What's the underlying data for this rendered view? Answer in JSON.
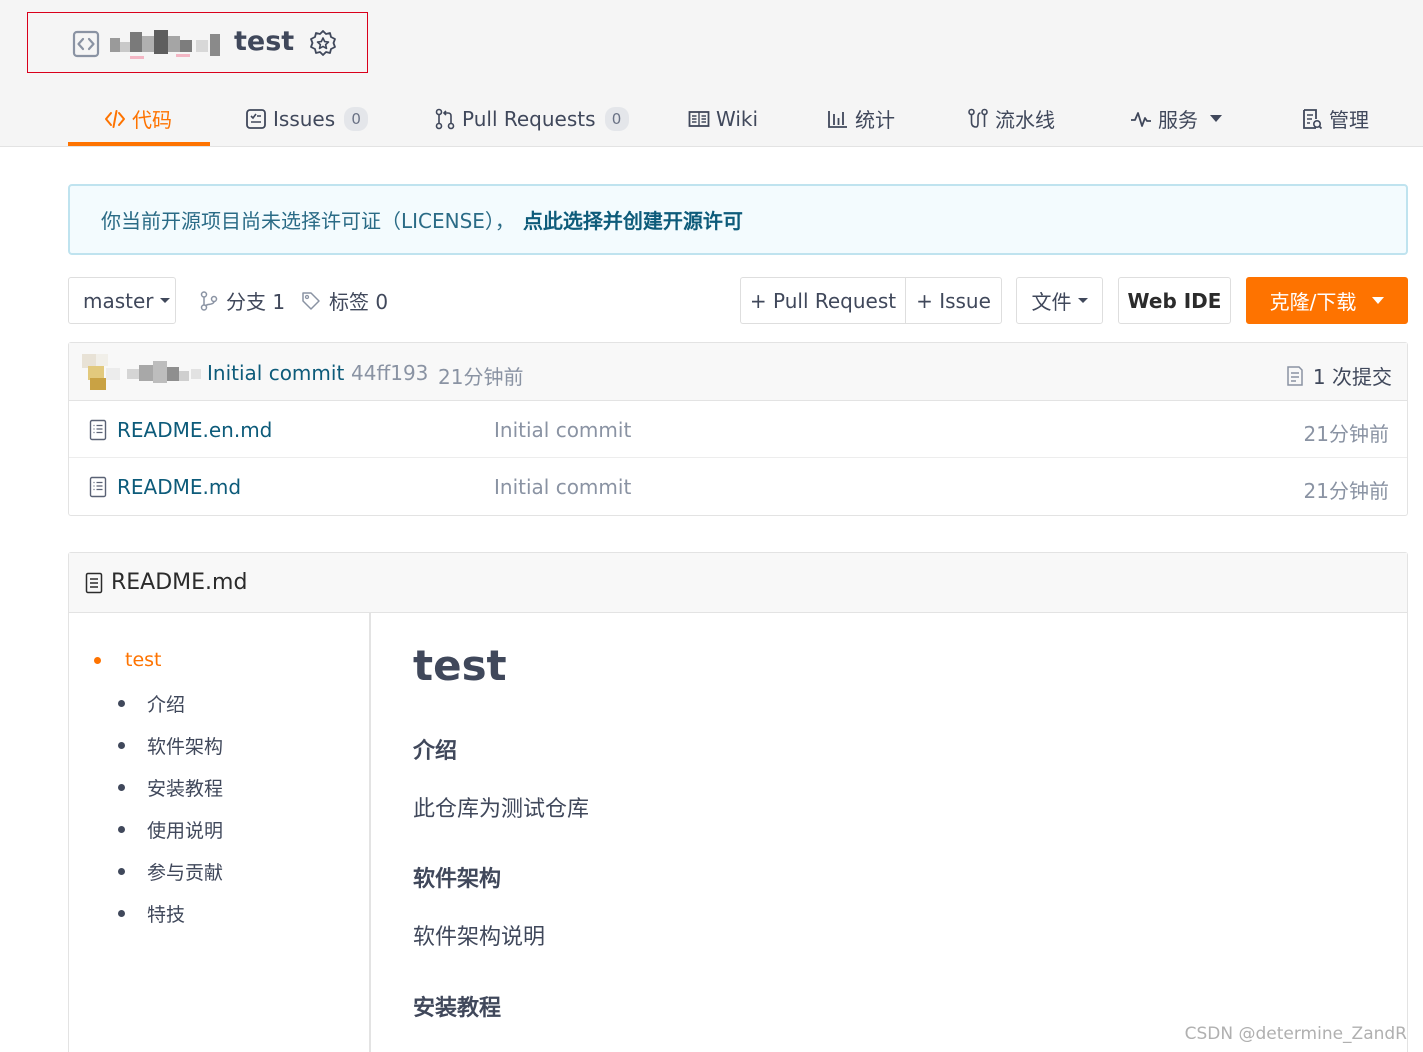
{
  "repo": {
    "name": "test"
  },
  "tabs": [
    {
      "label": "代码",
      "icon": "code-icon"
    },
    {
      "label": "Issues",
      "count": "0",
      "icon": "issues-icon"
    },
    {
      "label": "Pull Requests",
      "count": "0",
      "icon": "pull-request-icon"
    },
    {
      "label": "Wiki",
      "icon": "wiki-icon"
    },
    {
      "label": "统计",
      "icon": "stats-icon"
    },
    {
      "label": "流水线",
      "icon": "pipeline-icon"
    },
    {
      "label": "服务",
      "icon": "pulse-icon"
    },
    {
      "label": "管理",
      "icon": "manage-icon"
    }
  ],
  "notice": {
    "text": "你当前开源项目尚未选择许可证（LICENSE），",
    "link": "点此选择并创建开源许可"
  },
  "toolbar": {
    "branch": "master",
    "branches": "分支 1",
    "tags": "标签 0",
    "pull_request_button": "+ Pull Request",
    "issue_button": "+ Issue",
    "file_button": "文件",
    "webide_button": "Web IDE",
    "clone_button": "克隆/下载"
  },
  "latest_commit": {
    "message": "Initial commit",
    "hash": "44ff193",
    "time": "21分钟前",
    "count": "1 次提交"
  },
  "files": [
    {
      "name": "README.en.md",
      "commit": "Initial commit",
      "time": "21分钟前"
    },
    {
      "name": "README.md",
      "commit": "Initial commit",
      "time": "21分钟前"
    }
  ],
  "readme": {
    "filename": "README.md",
    "toc": [
      "test",
      "介绍",
      "软件架构",
      "安装教程",
      "使用说明",
      "参与贡献",
      "特技"
    ],
    "title": "test",
    "sections": [
      {
        "heading": "介绍",
        "text": "此仓库为测试仓库"
      },
      {
        "heading": "软件架构",
        "text": "软件架构说明"
      },
      {
        "heading": "安装教程",
        "text": ""
      }
    ]
  },
  "watermark": "CSDN @determine_ZandR",
  "colors": {
    "accent": "#fe7300",
    "link": "#0d5b7a",
    "text": "#40485b",
    "highlight_border": "#d9001b"
  }
}
